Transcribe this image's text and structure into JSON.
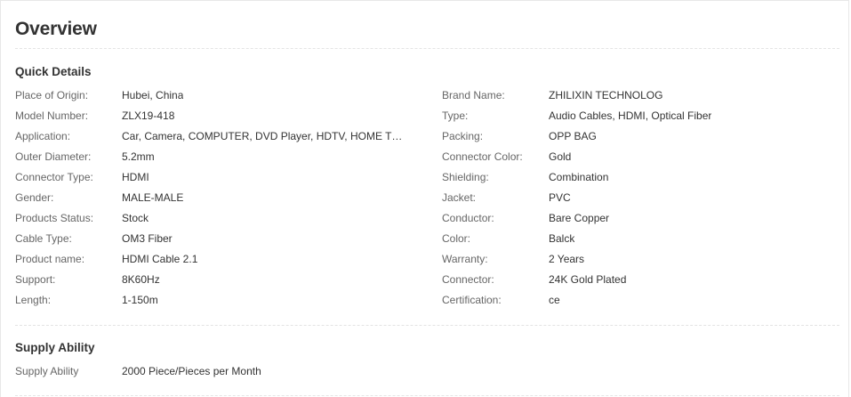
{
  "overview": {
    "title": "Overview"
  },
  "quick_details": {
    "title": "Quick Details",
    "left": [
      {
        "label": "Place of Origin:",
        "value": "Hubei, China"
      },
      {
        "label": "Model Number:",
        "value": "ZLX19-418"
      },
      {
        "label": "Application:",
        "value": "Car, Camera, COMPUTER, DVD Player, HDTV, HOME THEATE..."
      },
      {
        "label": "Outer Diameter:",
        "value": "5.2mm"
      },
      {
        "label": "Connector Type:",
        "value": "HDMI"
      },
      {
        "label": "Gender:",
        "value": "MALE-MALE"
      },
      {
        "label": "Products Status:",
        "value": "Stock"
      },
      {
        "label": "Cable Type:",
        "value": "OM3 Fiber"
      },
      {
        "label": "Product name:",
        "value": "HDMI Cable 2.1"
      },
      {
        "label": "Support:",
        "value": "8K60Hz"
      },
      {
        "label": "Length:",
        "value": "1-150m"
      }
    ],
    "right": [
      {
        "label": "Brand Name:",
        "value": "ZHILIXIN TECHNOLOG"
      },
      {
        "label": "Type:",
        "value": "Audio Cables, HDMI, Optical Fiber"
      },
      {
        "label": "Packing:",
        "value": "OPP BAG"
      },
      {
        "label": "Connector Color:",
        "value": "Gold"
      },
      {
        "label": "Shielding:",
        "value": "Combination"
      },
      {
        "label": "Jacket:",
        "value": "PVC"
      },
      {
        "label": "Conductor:",
        "value": "Bare Copper"
      },
      {
        "label": "Color:",
        "value": "Balck"
      },
      {
        "label": "Warranty:",
        "value": "2 Years"
      },
      {
        "label": "Connector:",
        "value": "24K Gold Plated"
      },
      {
        "label": "Certification:",
        "value": "ce"
      }
    ]
  },
  "supply_ability": {
    "title": "Supply Ability",
    "rows": [
      {
        "label": "Supply Ability",
        "value": "2000 Piece/Pieces per Month"
      }
    ]
  }
}
